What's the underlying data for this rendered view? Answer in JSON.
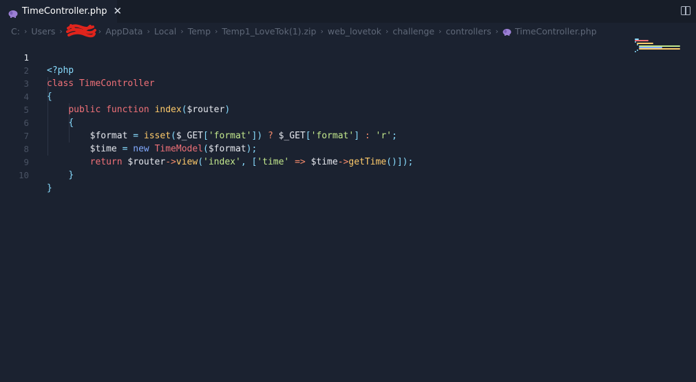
{
  "tab": {
    "title": "TimeController.php",
    "close": "✕"
  },
  "breadcrumb": {
    "items": [
      "C:",
      "Users",
      "AppData",
      "Local",
      "Temp",
      "Temp1_LoveTok(1).zip",
      "web_lovetok",
      "challenge",
      "controllers"
    ],
    "file": "TimeController.php",
    "separator": "›"
  },
  "editor": {
    "active_line": 1,
    "line_numbers": [
      "1",
      "2",
      "3",
      "4",
      "5",
      "6",
      "7",
      "8",
      "9",
      "10"
    ],
    "code": {
      "l1": {
        "open_tag": "<?php"
      },
      "l2": {
        "kw": "class",
        "name": "TimeController"
      },
      "l3": {
        "brace": "{"
      },
      "l4": {
        "vis": "public",
        "kw": "function",
        "name": "index",
        "p1": "(",
        "arg": "$router",
        "p2": ")"
      },
      "l5": {
        "brace": "{"
      },
      "l6": {
        "var": "$format",
        "eq": "=",
        "fn": "isset",
        "p1": "(",
        "get1": "$_GET",
        "b1": "[",
        "s1": "'format'",
        "b2": "]",
        "p2": ")",
        "q": "?",
        "get2": "$_GET",
        "b3": "[",
        "s2": "'format'",
        "b4": "]",
        "colon": ":",
        "s3": "'r'",
        "semi": ";"
      },
      "l7": {
        "var": "$time",
        "eq": "=",
        "new": "new",
        "cls": "TimeModel",
        "p1": "(",
        "arg": "$format",
        "p2": ");"
      },
      "l8": {
        "ret": "return",
        "var": "$router",
        "arrow1": "->",
        "fn": "view",
        "p1": "(",
        "s1": "'index'",
        "comma": ",",
        "b1": "[",
        "s2": "'time'",
        "darrow": "=>",
        "var2": "$time",
        "arrow2": "->",
        "fn2": "getTime",
        "p2": "()",
        "end": "]);"
      },
      "l9": {
        "brace": "}"
      },
      "l10": {
        "brace": "}"
      }
    }
  },
  "colors": {
    "background": "#1b2230",
    "keyword": "#f07178",
    "function": "#ffcb6b",
    "string": "#c3e88d",
    "punctuation": "#89ddff",
    "operator": "#f78c6c",
    "new_keyword": "#82aaff"
  },
  "icons": [
    "php-elephant-icon",
    "close-icon",
    "split-editor-icon",
    "redaction-scribble"
  ]
}
